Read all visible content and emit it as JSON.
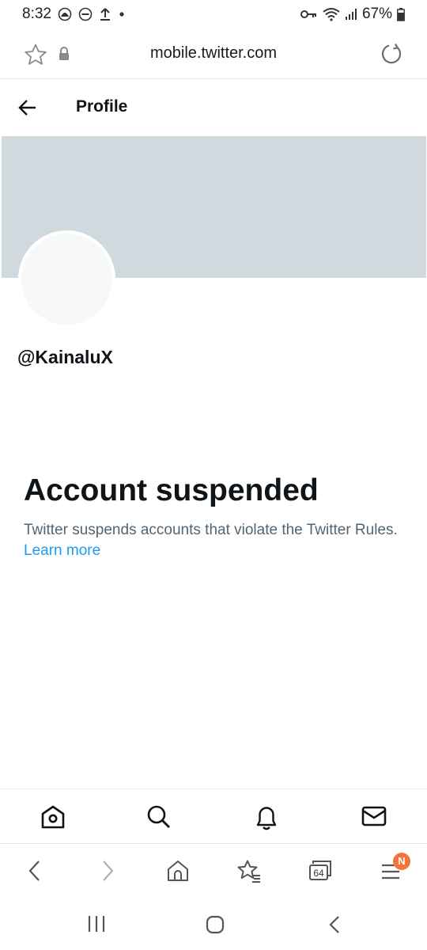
{
  "status_bar": {
    "time": "8:32",
    "battery": "67%"
  },
  "browser": {
    "url": "mobile.twitter.com",
    "tabs_count": "64",
    "menu_badge": "N"
  },
  "header": {
    "title": "Profile"
  },
  "profile": {
    "handle": "@KainaluX"
  },
  "suspension": {
    "title": "Account suspended",
    "message": "Twitter suspends accounts that violate the Twitter Rules.",
    "link_label": "Learn more"
  },
  "colors": {
    "banner": "#cfd9de",
    "link": "#1d9bf0",
    "badge": "#f5743b"
  },
  "icons": {
    "tw_nav": [
      "home-icon",
      "search-icon",
      "bell-icon",
      "mail-icon"
    ],
    "browser_toolbar": [
      "back-icon",
      "forward-icon",
      "home-icon",
      "bookmarks-icon",
      "tabs-icon",
      "menu-icon"
    ]
  }
}
